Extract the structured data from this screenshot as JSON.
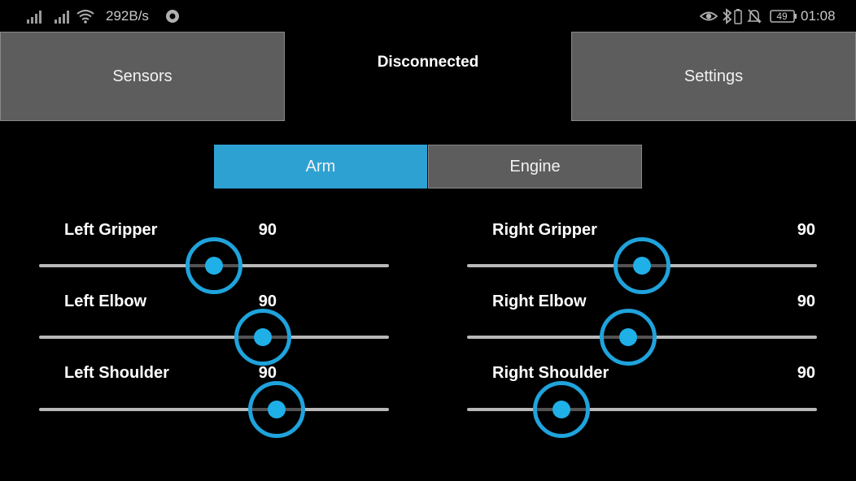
{
  "status_bar": {
    "net_speed": "292B/s",
    "battery_level": "49",
    "time": "01:08"
  },
  "header": {
    "sensors_label": "Sensors",
    "connection_status": "Disconnected",
    "settings_label": "Settings"
  },
  "tabs": [
    {
      "label": "Arm",
      "active": true
    },
    {
      "label": "Engine",
      "active": false
    }
  ],
  "sliders": [
    {
      "label": "Left Gripper",
      "value": "90",
      "position": 0.5
    },
    {
      "label": "Left Elbow",
      "value": "90",
      "position": 0.64
    },
    {
      "label": "Left Shoulder",
      "value": "90",
      "position": 0.68
    },
    {
      "label": "Right Gripper",
      "value": "90",
      "position": 0.5
    },
    {
      "label": "Right Elbow",
      "value": "90",
      "position": 0.46
    },
    {
      "label": "Right Shoulder",
      "value": "90",
      "position": 0.27
    }
  ],
  "colors": {
    "accent": "#1fa3dc",
    "button_bg": "#5d5d5d",
    "active_tab": "#2ea1d3"
  }
}
